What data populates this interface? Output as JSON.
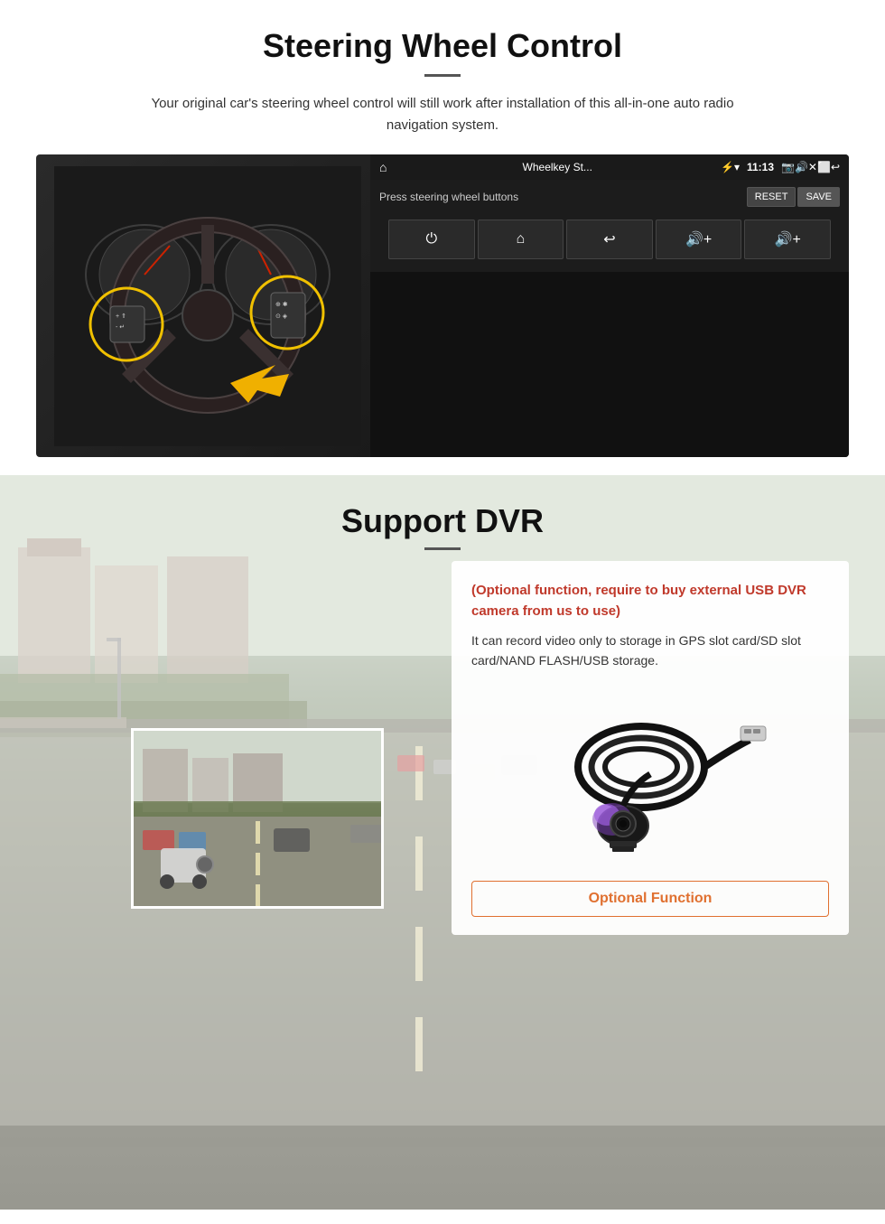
{
  "swc": {
    "title": "Steering Wheel Control",
    "subtitle": "Your original car's steering wheel control will still work after installation of this all-in-one auto radio navigation system.",
    "screen": {
      "app_name": "Wheelkey St...",
      "time": "11:13",
      "press_label": "Press steering wheel buttons",
      "reset_btn": "RESET",
      "save_btn": "SAVE",
      "control_icons": [
        "⏻",
        "⌂",
        "↩",
        "🔊+",
        "🔊+"
      ]
    }
  },
  "dvr": {
    "title": "Support DVR",
    "optional_note": "(Optional function, require to buy external USB DVR camera from us to use)",
    "description": "It can record video only to storage in GPS slot card/SD slot card/NAND FLASH/USB storage.",
    "optional_function_label": "Optional Function"
  }
}
